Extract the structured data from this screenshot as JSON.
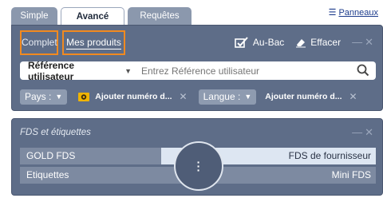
{
  "tabs": [
    {
      "label": "Simple",
      "active": false
    },
    {
      "label": "Avancé",
      "active": true
    },
    {
      "label": "Requêtes",
      "active": false
    }
  ],
  "panneaux_label": "Panneaux",
  "search_panel": {
    "modes": [
      {
        "label": "Complet",
        "selected": false
      },
      {
        "label": "Mes produits",
        "selected": true
      }
    ],
    "toolbar": {
      "au_bac_label": "Au-Bac",
      "effacer_label": "Effacer"
    },
    "search": {
      "type_label": "Référence utilisateur",
      "placeholder": "Entrez Référence utilisateur"
    },
    "filters": {
      "pays_label": "Pays :",
      "add_country_number": "Ajouter numéro d...",
      "langue_label": "Langue :",
      "add_language_number": "Ajouter numéro d..."
    }
  },
  "fds_panel": {
    "title": "FDS et étiquettes",
    "rows": [
      {
        "left": "GOLD FDS",
        "right": "FDS de fournisseur"
      },
      {
        "left": "Etiquettes",
        "right": "Mini FDS"
      }
    ]
  },
  "colors": {
    "panel_bg": "#5e6d88",
    "highlight_border": "#f28a1f",
    "tab_inactive": "#8b98ad"
  }
}
